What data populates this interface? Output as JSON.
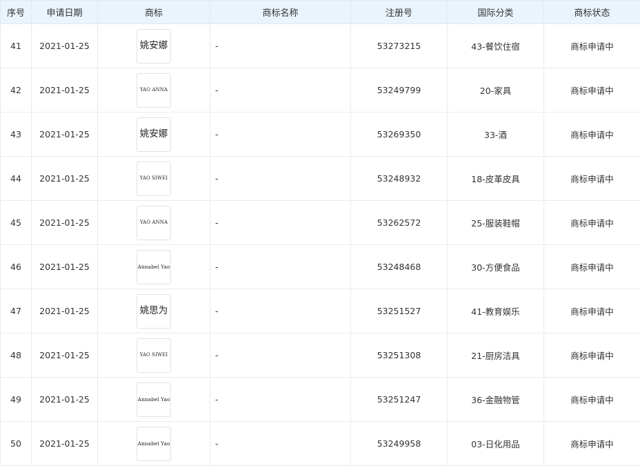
{
  "table": {
    "headers": {
      "seq": "序号",
      "date": "申请日期",
      "mark": "商标",
      "name": "商标名称",
      "reg": "注册号",
      "cls": "国际分类",
      "status": "商标状态"
    },
    "rows": [
      {
        "seq": "41",
        "date": "2021-01-25",
        "mark": "姚安娜",
        "mark_style": "cjk",
        "name": "-",
        "reg": "53273215",
        "cls": "43-餐饮住宿",
        "status": "商标申请中"
      },
      {
        "seq": "42",
        "date": "2021-01-25",
        "mark": "YAO ANNA",
        "mark_style": "latin-caps",
        "name": "-",
        "reg": "53249799",
        "cls": "20-家具",
        "status": "商标申请中"
      },
      {
        "seq": "43",
        "date": "2021-01-25",
        "mark": "姚安娜",
        "mark_style": "cjk",
        "name": "-",
        "reg": "53269350",
        "cls": "33-酒",
        "status": "商标申请中"
      },
      {
        "seq": "44",
        "date": "2021-01-25",
        "mark": "YAO SIWEI",
        "mark_style": "latin-caps",
        "name": "-",
        "reg": "53248932",
        "cls": "18-皮革皮具",
        "status": "商标申请中"
      },
      {
        "seq": "45",
        "date": "2021-01-25",
        "mark": "YAO ANNA",
        "mark_style": "latin-caps",
        "name": "-",
        "reg": "53262572",
        "cls": "25-服装鞋帽",
        "status": "商标申请中"
      },
      {
        "seq": "46",
        "date": "2021-01-25",
        "mark": "Annabel Yao",
        "mark_style": "latin-mixed",
        "name": "-",
        "reg": "53248468",
        "cls": "30-方便食品",
        "status": "商标申请中"
      },
      {
        "seq": "47",
        "date": "2021-01-25",
        "mark": "姚思为",
        "mark_style": "cjk",
        "name": "-",
        "reg": "53251527",
        "cls": "41-教育娱乐",
        "status": "商标申请中"
      },
      {
        "seq": "48",
        "date": "2021-01-25",
        "mark": "YAO SIWEI",
        "mark_style": "latin-caps",
        "name": "-",
        "reg": "53251308",
        "cls": "21-厨房洁具",
        "status": "商标申请中"
      },
      {
        "seq": "49",
        "date": "2021-01-25",
        "mark": "Annabel Yao",
        "mark_style": "latin-mixed",
        "name": "-",
        "reg": "53251247",
        "cls": "36-金融物管",
        "status": "商标申请中"
      },
      {
        "seq": "50",
        "date": "2021-01-25",
        "mark": "Annabel Yao",
        "mark_style": "latin-mixed",
        "name": "-",
        "reg": "53249958",
        "cls": "03-日化用品",
        "status": "商标申请中"
      }
    ]
  }
}
